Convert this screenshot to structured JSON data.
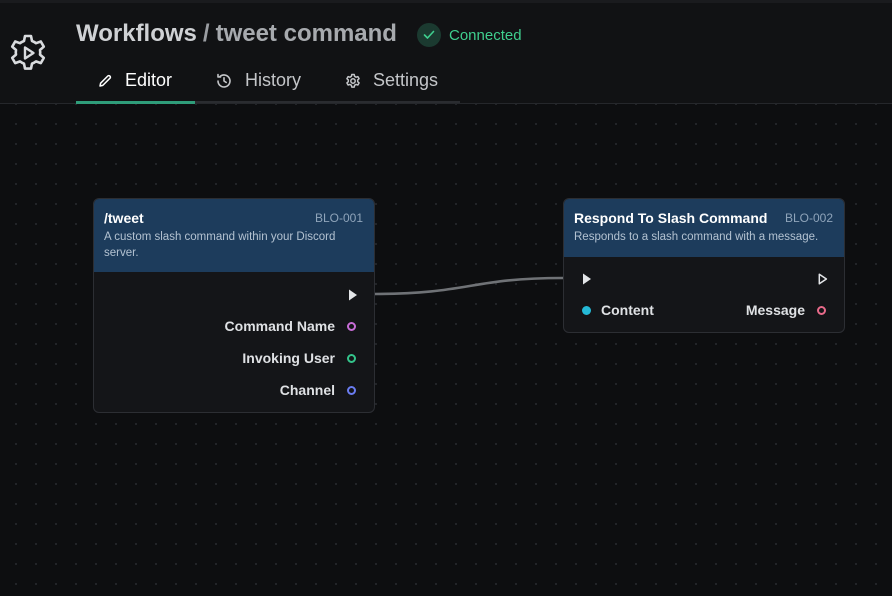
{
  "header": {
    "breadcrumb_root": "Workflows",
    "breadcrumb_sep": "/",
    "breadcrumb_current": "tweet command",
    "status": "Connected",
    "status_color": "#3fcf8e",
    "logo_icon": "gear-play-icon"
  },
  "tabs": [
    {
      "label": "Editor",
      "icon": "pencil-icon",
      "active": true
    },
    {
      "label": "History",
      "icon": "history-icon",
      "active": false
    },
    {
      "label": "Settings",
      "icon": "gear-icon",
      "active": false
    }
  ],
  "nodes": [
    {
      "title": "/tweet",
      "id": "BLO-001",
      "description": "A custom slash command within your Discord server.",
      "outputs": [
        {
          "label": "Command Name",
          "color": "#c86dd7"
        },
        {
          "label": "Invoking User",
          "color": "#34c48b"
        },
        {
          "label": "Channel",
          "color": "#6a7cf0"
        }
      ]
    },
    {
      "title": "Respond To Slash Command",
      "id": "BLO-002",
      "description": "Responds to a slash command with a message.",
      "inputs": [
        {
          "label": "Content",
          "color": "#25b9d6"
        }
      ],
      "outputs": [
        {
          "label": "Message",
          "color": "#e86a8a"
        }
      ]
    }
  ]
}
